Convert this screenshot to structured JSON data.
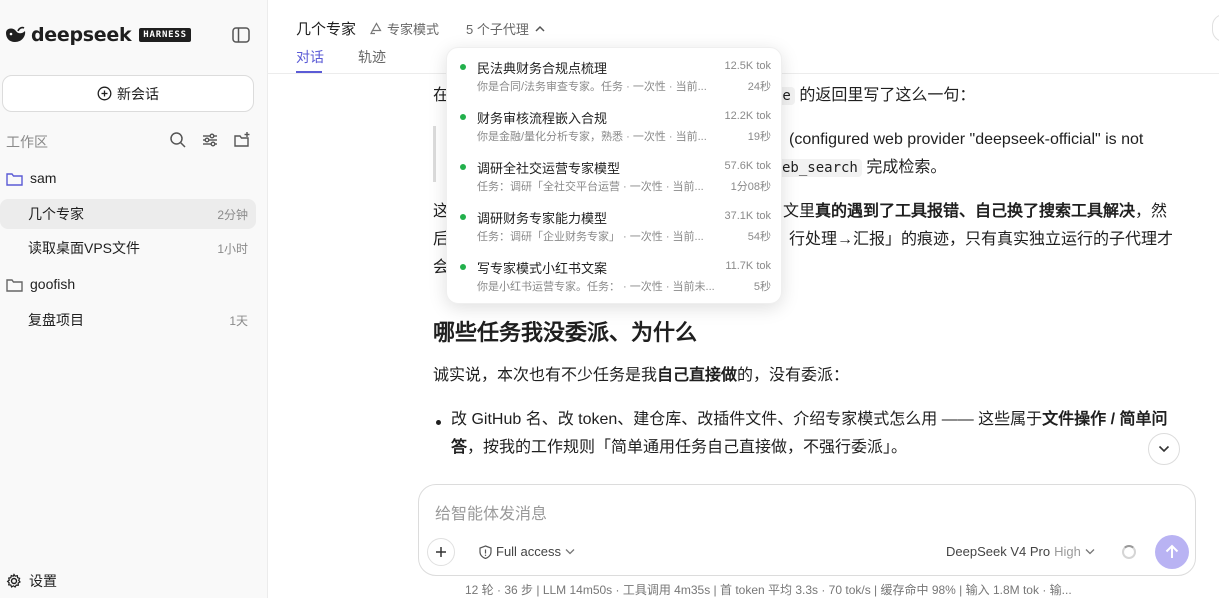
{
  "brand": {
    "wordmark": "deepseek",
    "badge": "HARNESS"
  },
  "sidebar": {
    "new_chat_label": "新会话",
    "workspace_label": "工作区",
    "groups": [
      {
        "name": "sam",
        "sessions": [
          {
            "title": "几个专家",
            "time": "2分钟",
            "active": true
          },
          {
            "title": "读取桌面VPS文件",
            "time": "1小时",
            "active": false
          }
        ]
      },
      {
        "name": "goofish",
        "sessions": [
          {
            "title": "复盘项目",
            "time": "1天",
            "active": false
          }
        ]
      }
    ],
    "settings_label": "设置"
  },
  "header": {
    "title": "几个专家",
    "expert_mode": "专家模式",
    "subagent_count": "5 个子代理",
    "tabs": [
      "对话",
      "轨迹"
    ]
  },
  "subagents": [
    {
      "name": "民法典财务合规点梳理",
      "desc": "你是合同/法务审查专家。任务 · 一次性 · 当前...",
      "tokens": "12.5K tok",
      "duration": "24秒"
    },
    {
      "name": "财务审核流程嵌入合规",
      "desc": "你是金融/量化分析专家，熟悉 · 一次性 · 当前...",
      "tokens": "12.2K tok",
      "duration": "19秒"
    },
    {
      "name": "调研全社交运营专家模型",
      "desc": "任务：调研「全社交平台运营 · 一次性 · 当前...",
      "tokens": "57.6K tok",
      "duration": "1分08秒"
    },
    {
      "name": "调研财务专家能力模型",
      "desc": "任务：调研「企业财务专家」 · 一次性 · 当前...",
      "tokens": "37.1K tok",
      "duration": "54秒"
    },
    {
      "name": "写专家模式小红书文案",
      "desc": "你是小红书运营专家。任务： · 一次性 · 当前未...",
      "tokens": "11.7K tok",
      "duration": "5秒"
    }
  ],
  "content": {
    "p1_a": "在",
    "p1_code": "ce",
    "p1_b": "的返回里写了这么一句：",
    "q1": "(configured web provider \"deepseek-official\" is not",
    "q2_code": "eb_search",
    "q2_b": "完成检索。",
    "p2_a": "这",
    "p2_b": "文里",
    "p2_bold": "真的遇到了工具报错、自己换了搜索工具解决",
    "p2_c": "，然",
    "p3_a": "后",
    "p3_b": "行处理→汇报」的痕迹，只有真实独立运行的子代理才",
    "p4_a": "会",
    "heading": "哪些任务我没委派、为什么",
    "p5_a": "诚实说，本次也有不少任务是我",
    "p5_bold": "自己直接做",
    "p5_b": "的，没有委派：",
    "li1_a": "改 GitHub 名、改 token、建仓库、改插件文件、介绍专家模式怎么用 —— 这些属于",
    "li1_bold": "文件操作 / 简单问",
    "li2_bold": "答",
    "li2_b": "，按我的工作规则「简单通用任务自己直接做，不强行委派」。"
  },
  "composer": {
    "placeholder": "给智能体发消息",
    "access": "Full access",
    "model": "DeepSeek V4 Pro",
    "effort": "High"
  },
  "status_bar": "12 轮 · 36 步   |   LLM 14m50s · 工具调用 4m35s   |   首 token 平均 3.3s · 70 tok/s   |   缓存命中 98%   |   输入 1.8M tok · 输...",
  "colors": {
    "accent": "#5b5bd6",
    "running_dot": "#22b04b",
    "send_button": "#b9b3f3"
  },
  "icons": [
    "whale-logo-icon",
    "sidebar-toggle-icon",
    "plus-circle-icon",
    "search-icon",
    "sliders-icon",
    "new-folder-icon",
    "folder-icon",
    "gear-icon",
    "recycle-icon",
    "chevron-up-icon",
    "chevron-down-icon",
    "plus-icon",
    "shield-icon",
    "arrow-up-icon"
  ]
}
